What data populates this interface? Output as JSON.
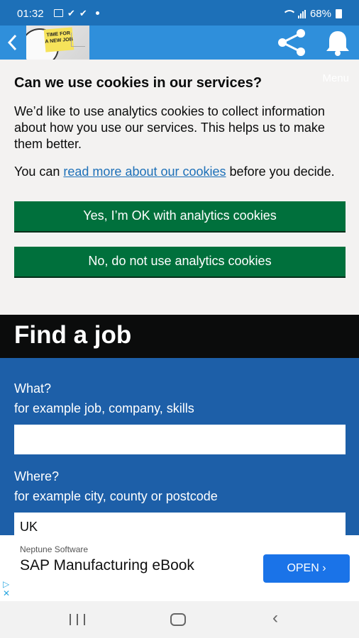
{
  "status_bar": {
    "time": "01:32",
    "battery": "68%"
  },
  "app_bar": {
    "logo_text": "TIME FOR A NEW JOB"
  },
  "cookie_banner": {
    "title": "Can we use cookies in our services?",
    "menu_ghost": "Menu",
    "paragraph1": "We’d like to use analytics cookies to collect information about how you use our services. This helps us to make them better.",
    "p2_prefix": "You can ",
    "p2_link": "read more about our cookies",
    "p2_suffix": " before you decide.",
    "accept_label": "Yes, I’m OK with analytics cookies",
    "reject_label": "No, do not use analytics cookies"
  },
  "find_job": {
    "title": "Find a job",
    "what_label": "What?",
    "what_hint": "for example job, company, skills",
    "what_value": "",
    "where_label": "Where?",
    "where_hint": "for example city, county or postcode",
    "where_value": "UK"
  },
  "ad": {
    "advertiser": "Neptune Software",
    "headline": "SAP Manufacturing eBook",
    "cta": "OPEN ›"
  },
  "colors": {
    "status_bar": "#1d70b8",
    "app_bar": "#2f8fdb",
    "button_green": "#00703c",
    "search_panel": "#1d5fa8",
    "ad_button": "#1a73e8"
  }
}
